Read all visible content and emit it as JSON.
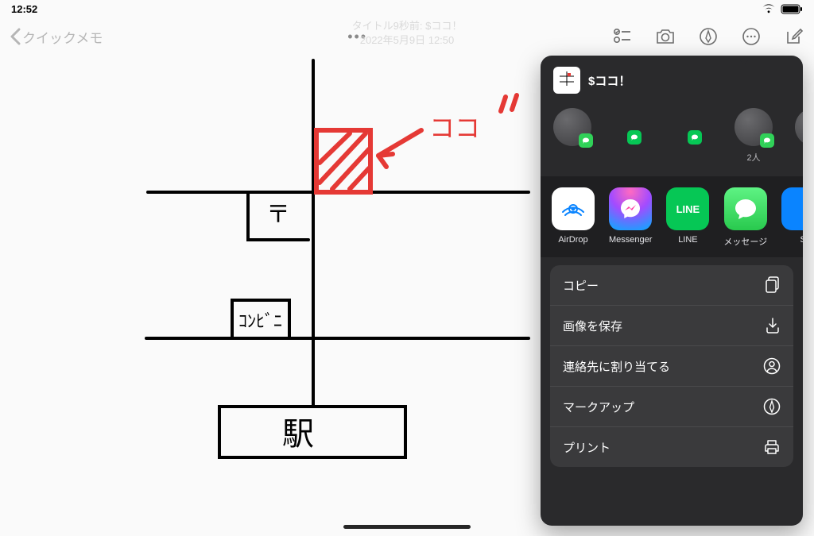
{
  "status": {
    "time": "12:52"
  },
  "toolbar": {
    "back_label": "クイックメモ"
  },
  "faint": {
    "line1": "タイトル9秒前: $ココ！",
    "line2": "2022年5月9日 12:50"
  },
  "sketch": {
    "koko_label": "ココ‼︎",
    "post_label": "〒",
    "conv_label": "ｺﾝﾋﾞﾆ",
    "station_label": "駅"
  },
  "share": {
    "title": "$ココ！",
    "contacts_extra_label": "2人",
    "apps": {
      "airdrop": "AirDrop",
      "messenger": "Messenger",
      "line": "LINE",
      "message": "メッセージ",
      "extra": "S"
    },
    "actions": {
      "copy": "コピー",
      "save_image": "画像を保存",
      "assign": "連絡先に割り当てる",
      "markup": "マークアップ",
      "print": "プリント"
    }
  }
}
